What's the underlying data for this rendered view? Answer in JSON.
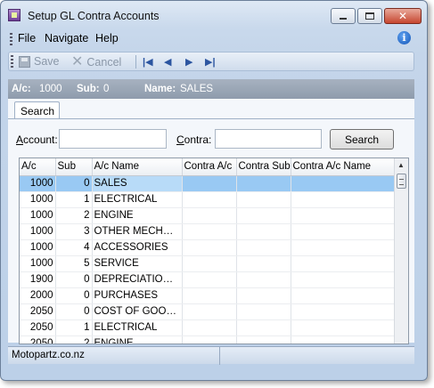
{
  "window": {
    "title": "Setup GL Contra Accounts"
  },
  "menu": {
    "items": [
      "File",
      "Navigate",
      "Help"
    ]
  },
  "toolbar": {
    "save_label": "Save",
    "cancel_label": "Cancel"
  },
  "info": {
    "ac_label": "A/c:",
    "ac_value": "1000",
    "sub_label": "Sub:",
    "sub_value": "0",
    "name_label": "Name:",
    "name_value": "SALES"
  },
  "tabs": [
    {
      "label": "Search"
    }
  ],
  "search": {
    "account_label_ul": "A",
    "account_label_rest": "ccount:",
    "account_value": "",
    "contra_label_ul": "C",
    "contra_label_rest": "ontra:",
    "contra_value": "",
    "button_label": "Search"
  },
  "grid": {
    "columns": [
      "A/c",
      "Sub",
      "A/c Name",
      "Contra A/c",
      "Contra Sub",
      "Contra A/c Name"
    ],
    "rows": [
      {
        "ac": "1000",
        "sub": "0",
        "name": "SALES",
        "selected": true
      },
      {
        "ac": "1000",
        "sub": "1",
        "name": "ELECTRICAL"
      },
      {
        "ac": "1000",
        "sub": "2",
        "name": "ENGINE"
      },
      {
        "ac": "1000",
        "sub": "3",
        "name": "OTHER MECHANI..."
      },
      {
        "ac": "1000",
        "sub": "4",
        "name": "ACCESSORIES"
      },
      {
        "ac": "1000",
        "sub": "5",
        "name": "SERVICE"
      },
      {
        "ac": "1900",
        "sub": "0",
        "name": "DEPRECIATION R..."
      },
      {
        "ac": "2000",
        "sub": "0",
        "name": "PURCHASES"
      },
      {
        "ac": "2050",
        "sub": "0",
        "name": "COST OF GOODS ..."
      },
      {
        "ac": "2050",
        "sub": "1",
        "name": "ELECTRICAL"
      },
      {
        "ac": "2050",
        "sub": "2",
        "name": "ENGINE"
      }
    ]
  },
  "status": {
    "text": "Motopartz.co.nz"
  },
  "colors": {
    "selected_row": "#99c9f3",
    "info_bar": "#97a3b3",
    "window_chrome": "#c9d9ec"
  }
}
